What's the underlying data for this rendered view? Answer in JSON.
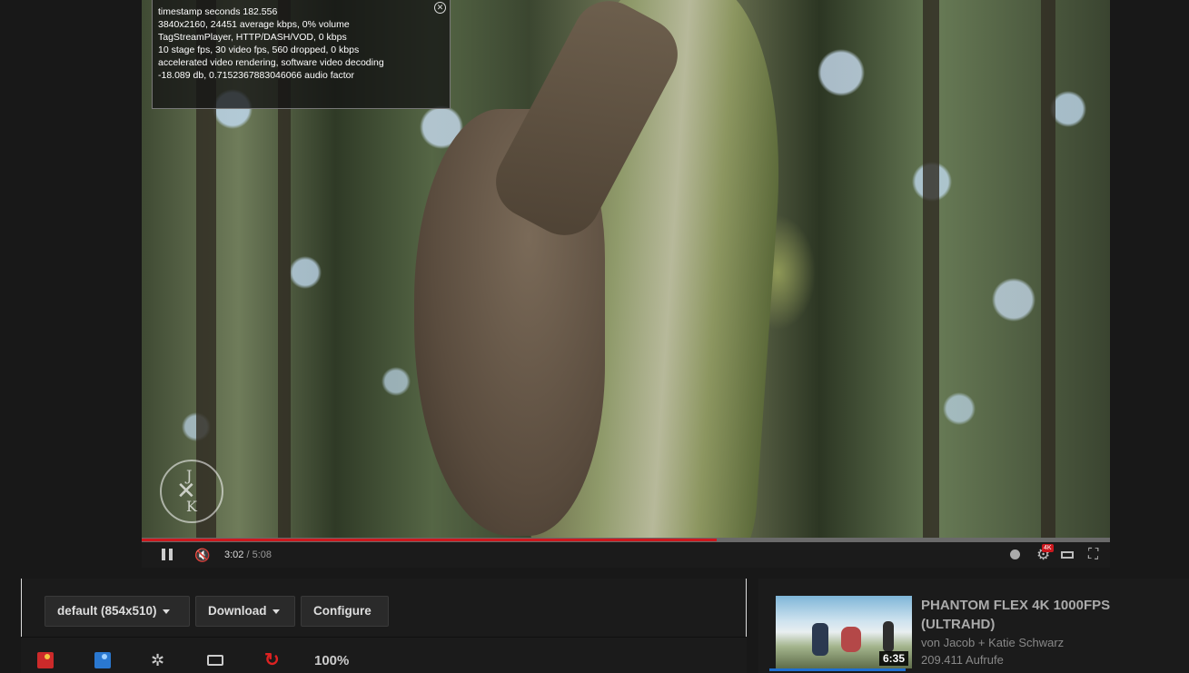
{
  "stats": {
    "lines": [
      "timestamp seconds 182.556",
      "3840x2160, 24451 average kbps, 0% volume",
      "TagStreamPlayer, HTTP/DASH/VOD, 0 kbps",
      "10 stage fps, 30 video fps, 560 dropped, 0 kbps",
      "accelerated video rendering, software video decoding",
      "-18.089 db, 0.7152367883046066 audio factor"
    ],
    "close_icon": "close-icon"
  },
  "watermark": {
    "top": "J",
    "bottom": "K",
    "cross": "✕"
  },
  "player": {
    "progress_fraction": 0.594,
    "time_current": "3:02",
    "time_total": "5:08",
    "time_sep": " / ",
    "badge": "4K",
    "accent": "#cc181e",
    "icons": {
      "pause": "pause-icon",
      "mute": "🔇",
      "settings": "⚙",
      "fullscreen": "⛶"
    }
  },
  "toolbar": {
    "resolution_label": "default (854x510)",
    "download_label": "Download",
    "configure_label": "Configure",
    "settings_glyph": "✲",
    "replay_glyph": "↻",
    "zoom": "100%"
  },
  "related": {
    "title": "PHANTOM FLEX 4K 1000FPS (ULTRAHD)",
    "author": "von Jacob + Katie Schwarz",
    "views": "209.411 Aufrufe",
    "duration": "6:35"
  }
}
